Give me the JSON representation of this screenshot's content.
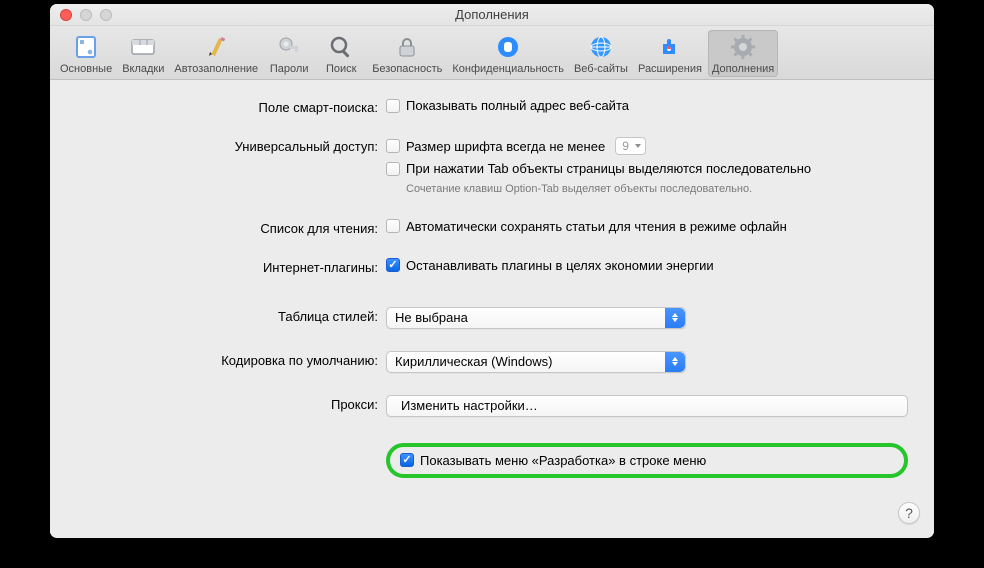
{
  "window": {
    "title": "Дополнения"
  },
  "toolbar": {
    "items": [
      {
        "label": "Основные",
        "icon": "general-icon"
      },
      {
        "label": "Вкладки",
        "icon": "tabs-icon"
      },
      {
        "label": "Автозаполнение",
        "icon": "autofill-icon"
      },
      {
        "label": "Пароли",
        "icon": "passwords-icon"
      },
      {
        "label": "Поиск",
        "icon": "search-icon"
      },
      {
        "label": "Безопасность",
        "icon": "security-icon"
      },
      {
        "label": "Конфиденциальность",
        "icon": "privacy-icon"
      },
      {
        "label": "Веб-сайты",
        "icon": "websites-icon"
      },
      {
        "label": "Расширения",
        "icon": "extensions-icon"
      },
      {
        "label": "Дополнения",
        "icon": "advanced-icon",
        "active": true
      }
    ]
  },
  "form": {
    "smart_search": {
      "label": "Поле смарт-поиска:",
      "full_address": {
        "text": "Показывать полный адрес веб-сайта",
        "checked": false
      }
    },
    "accessibility": {
      "label": "Универсальный доступ:",
      "min_font": {
        "text": "Размер шрифта всегда не менее",
        "checked": false,
        "value": "9"
      },
      "tab_highlight": {
        "text": "При нажатии Tab объекты страницы выделяются последовательно",
        "checked": false
      },
      "tab_hint": "Сочетание клавиш Option-Tab выделяет объекты последовательно."
    },
    "reading_list": {
      "label": "Список для чтения:",
      "auto_save": {
        "text": "Автоматически сохранять статьи для чтения в режиме офлайн",
        "checked": false
      }
    },
    "plugins": {
      "label": "Интернет-плагины:",
      "stop_power": {
        "text": "Останавливать плагины в целях экономии энергии",
        "checked": true
      }
    },
    "stylesheet": {
      "label": "Таблица стилей:",
      "value": "Не выбрана"
    },
    "encoding": {
      "label": "Кодировка по умолчанию:",
      "value": "Кириллическая (Windows)"
    },
    "proxies": {
      "label": "Прокси:",
      "button": "Изменить настройки…"
    },
    "develop": {
      "text": "Показывать меню «Разработка» в строке меню",
      "checked": true
    }
  },
  "help_button": "?"
}
